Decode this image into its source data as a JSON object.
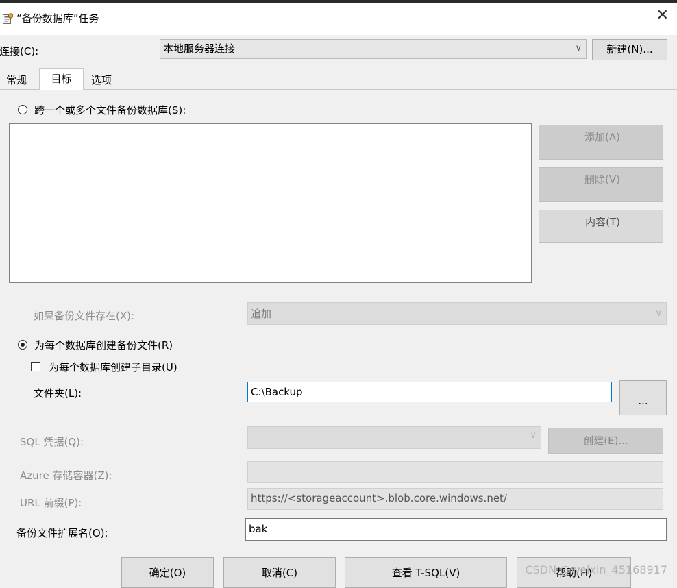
{
  "window": {
    "title": "“备份数据库”任务",
    "close_glyph": "✕"
  },
  "connection": {
    "label": "连接(C):",
    "selected": "本地服务器连接",
    "new_button": "新建(N)..."
  },
  "tabs": [
    {
      "label": "常规",
      "active": false
    },
    {
      "label": "目标",
      "active": true
    },
    {
      "label": "选项",
      "active": false
    }
  ],
  "target": {
    "radio_span_files": {
      "label": "跨一个或多个文件备份数据库(S):",
      "checked": false
    },
    "side_buttons": {
      "add": "添加(A)",
      "remove": "删除(V)",
      "contents": "内容(T)"
    },
    "if_exists": {
      "label": "如果备份文件存在(X):",
      "value": "追加"
    },
    "radio_per_db": {
      "label": "为每个数据库创建备份文件(R)",
      "checked": true
    },
    "subdir_checkbox": {
      "label": "为每个数据库创建子目录(U)",
      "checked": false
    },
    "folder": {
      "label": "文件夹(L):",
      "value": "C:\\Backup",
      "browse": "..."
    },
    "sql_credential": {
      "label": "SQL 凭据(Q):",
      "value": "",
      "create_button": "创建(E)..."
    },
    "azure_container": {
      "label": "Azure 存储容器(Z):",
      "value": ""
    },
    "url_prefix": {
      "label": "URL 前缀(P):",
      "value": "https://<storageaccount>.blob.core.windows.net/"
    },
    "extension": {
      "label": "备份文件扩展名(O):",
      "value": "bak"
    }
  },
  "footer": {
    "ok": "确定(O)",
    "cancel": "取消(C)",
    "view_tsql": "查看 T-SQL(V)",
    "help": "帮助(H)"
  },
  "watermark": "CSDN @weixin_45168917",
  "colors": {
    "focus_border": "#0078d7",
    "disabled_button": "#cccccc"
  }
}
